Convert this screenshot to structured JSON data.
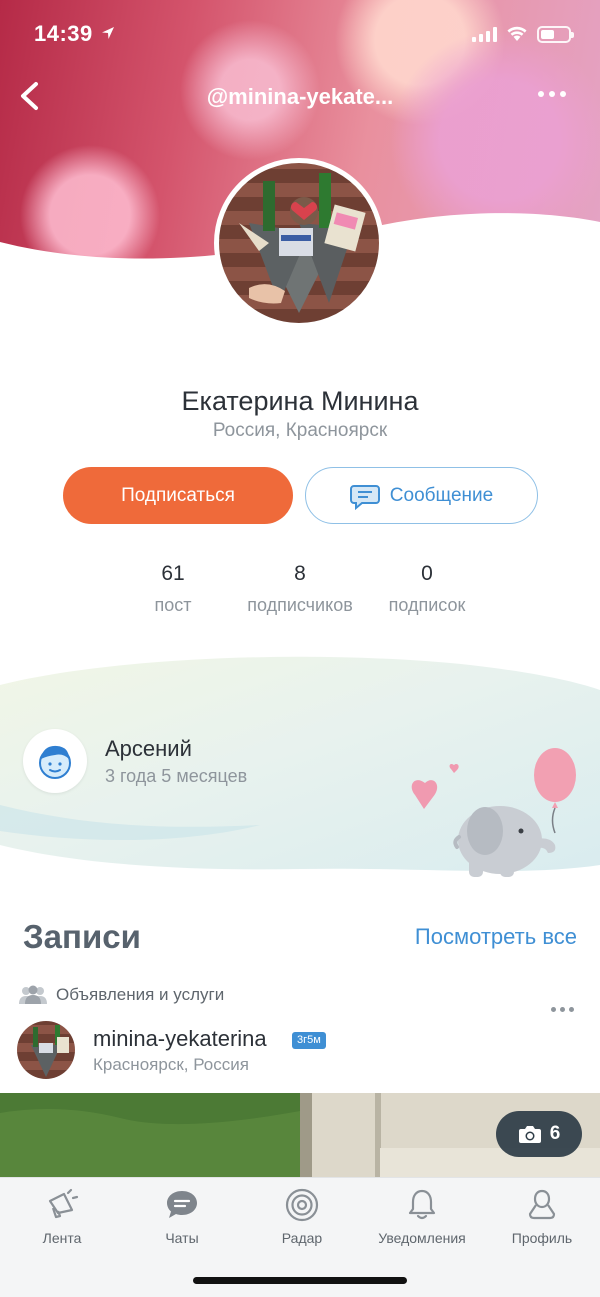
{
  "status_bar": {
    "time": "14:39"
  },
  "header": {
    "title": "@minina-yekate..."
  },
  "profile": {
    "name": "Екатерина Минина",
    "location": "Россия, Красноярск",
    "subscribe_label": "Подписаться",
    "message_label": "Сообщение"
  },
  "stats": [
    {
      "value": "61",
      "label": "пост"
    },
    {
      "value": "8",
      "label": "подписчиков"
    },
    {
      "value": "0",
      "label": "подписок"
    }
  ],
  "child": {
    "name": "Арсений",
    "age": "3 года 5 месяцев"
  },
  "posts_section": {
    "title": "Записи",
    "see_all": "Посмотреть все",
    "category": "Объявления и услуги",
    "author": "minina-yekaterina",
    "badge": "3г5м",
    "location": "Красноярск, Россия",
    "photo_count": "6"
  },
  "tab_bar": [
    {
      "label": "Лента",
      "icon": "megaphone-icon"
    },
    {
      "label": "Чаты",
      "icon": "chat-bubble-icon"
    },
    {
      "label": "Радар",
      "icon": "radar-icon"
    },
    {
      "label": "Уведомления",
      "icon": "bell-icon"
    },
    {
      "label": "Профиль",
      "icon": "person-icon"
    }
  ],
  "colors": {
    "accent_orange": "#ef6a3a",
    "accent_blue": "#3f8fd4",
    "text_dark": "#2c3138",
    "text_muted": "#8e959c"
  }
}
